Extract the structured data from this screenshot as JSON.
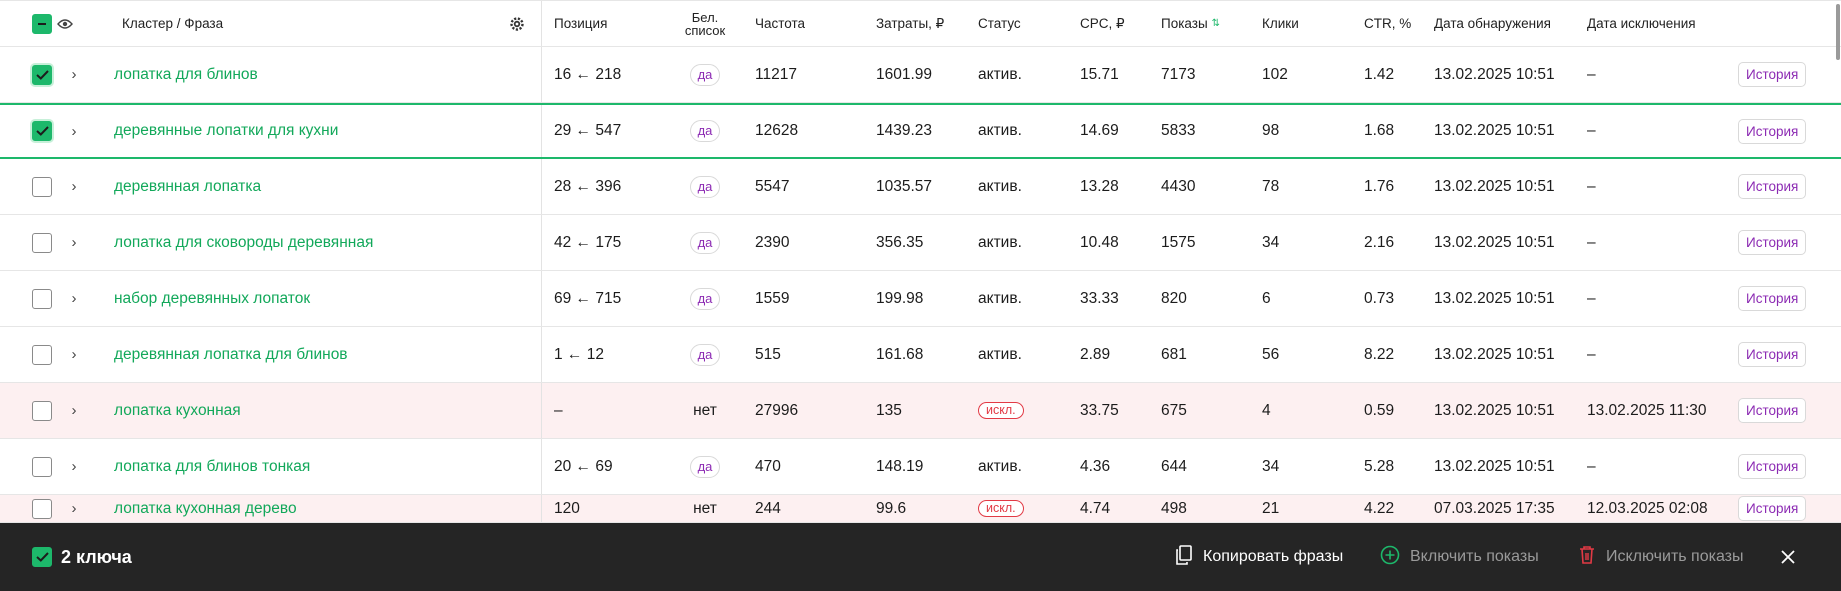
{
  "header": {
    "phrase_col": "Кластер / Фраза",
    "position": "Позиция",
    "whitelist_line1": "Бел.",
    "whitelist_line2": "список",
    "frequency": "Частота",
    "cost": "Затраты, ₽",
    "status": "Статус",
    "cpc": "CPC, ₽",
    "shows": "Показы",
    "clicks": "Клики",
    "ctr": "CTR, %",
    "found_date": "Дата обнаружения",
    "excluded_date": "Дата исключения"
  },
  "rows": [
    {
      "phrase": "лопатка для блинов",
      "position": "16 ← 218",
      "whitelist": "да",
      "frequency": "11217",
      "cost": "1601.99",
      "status": "актив.",
      "cpc": "15.71",
      "shows": "7173",
      "clicks": "102",
      "ctr": "1.42",
      "found": "13.02.2025 10:51",
      "excluded": "–",
      "history": "История",
      "checked": true
    },
    {
      "phrase": "деревянные лопатки для кухни",
      "position": "29 ← 547",
      "whitelist": "да",
      "frequency": "12628",
      "cost": "1439.23",
      "status": "актив.",
      "cpc": "14.69",
      "shows": "5833",
      "clicks": "98",
      "ctr": "1.68",
      "found": "13.02.2025 10:51",
      "excluded": "–",
      "history": "История",
      "checked": true
    },
    {
      "phrase": "деревянная лопатка",
      "position": "28 ← 396",
      "whitelist": "да",
      "frequency": "5547",
      "cost": "1035.57",
      "status": "актив.",
      "cpc": "13.28",
      "shows": "4430",
      "clicks": "78",
      "ctr": "1.76",
      "found": "13.02.2025 10:51",
      "excluded": "–",
      "history": "История",
      "checked": false
    },
    {
      "phrase": "лопатка для сковороды деревянная",
      "position": "42 ← 175",
      "whitelist": "да",
      "frequency": "2390",
      "cost": "356.35",
      "status": "актив.",
      "cpc": "10.48",
      "shows": "1575",
      "clicks": "34",
      "ctr": "2.16",
      "found": "13.02.2025 10:51",
      "excluded": "–",
      "history": "История",
      "checked": false
    },
    {
      "phrase": "набор деревянных лопаток",
      "position": "69 ← 715",
      "whitelist": "да",
      "frequency": "1559",
      "cost": "199.98",
      "status": "актив.",
      "cpc": "33.33",
      "shows": "820",
      "clicks": "6",
      "ctr": "0.73",
      "found": "13.02.2025 10:51",
      "excluded": "–",
      "history": "История",
      "checked": false
    },
    {
      "phrase": "деревянная лопатка для блинов",
      "position": "1 ← 12",
      "whitelist": "да",
      "frequency": "515",
      "cost": "161.68",
      "status": "актив.",
      "cpc": "2.89",
      "shows": "681",
      "clicks": "56",
      "ctr": "8.22",
      "found": "13.02.2025 10:51",
      "excluded": "–",
      "history": "История",
      "checked": false
    },
    {
      "phrase": "лопатка кухонная",
      "position": "–",
      "whitelist": "нет",
      "frequency": "27996",
      "cost": "135",
      "status": "искл.",
      "cpc": "33.75",
      "shows": "675",
      "clicks": "4",
      "ctr": "0.59",
      "found": "13.02.2025 10:51",
      "excluded": "13.02.2025 11:30",
      "history": "История",
      "checked": false
    },
    {
      "phrase": "лопатка для блинов тонкая",
      "position": "20 ← 69",
      "whitelist": "да",
      "frequency": "470",
      "cost": "148.19",
      "status": "актив.",
      "cpc": "4.36",
      "shows": "644",
      "clicks": "34",
      "ctr": "5.28",
      "found": "13.02.2025 10:51",
      "excluded": "–",
      "history": "История",
      "checked": false
    },
    {
      "phrase": "лопатка кухонная дерево",
      "position": "120",
      "whitelist": "нет",
      "frequency": "244",
      "cost": "99.6",
      "status": "искл.",
      "cpc": "4.74",
      "shows": "498",
      "clicks": "21",
      "ctr": "4.22",
      "found": "07.03.2025 17:35",
      "excluded": "12.03.2025 02:08",
      "history": "История",
      "checked": false
    }
  ],
  "bottom_bar": {
    "count_label": "2 ключа",
    "copy_label": "Копировать фразы",
    "enable_label": "Включить показы",
    "exclude_label": "Исключить показы"
  },
  "colors": {
    "accent": "#1db86b",
    "link": "#12a85a",
    "badge_purple": "#8c2bb3",
    "excluded_red": "#e23a45",
    "excluded_row_bg": "#fdf0f1",
    "bottom_bar_bg": "#252525"
  },
  "icons": {
    "header_select_all": "minus-checkbox-icon",
    "header_visibility": "eye-icon",
    "header_settings": "gear-icon",
    "row_expand": "chevron-right-icon",
    "copy": "copy-icon",
    "enable": "plus-circle-icon",
    "exclude": "trash-icon",
    "close": "close-icon",
    "sort": "sort-icon"
  }
}
